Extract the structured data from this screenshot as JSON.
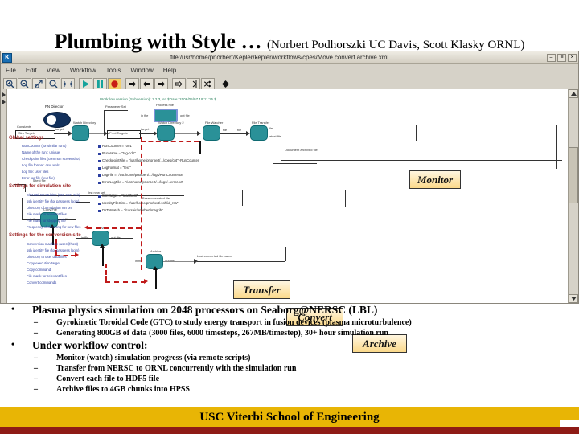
{
  "slide": {
    "title": "Plumbing with Style …",
    "subtitle": "(Norbert Podhorszki UC Davis, Scott Klasky ORNL)"
  },
  "window": {
    "app_icon": "K",
    "title": "file:/usr/home/pnorbert/Kepler/kepler/workflows/cpes/Move.convert.archive.xml",
    "buttons": {
      "minimize": "–",
      "maximize": "≡",
      "close": "×"
    },
    "menu": [
      "File",
      "Edit",
      "View",
      "Workflow",
      "Tools",
      "Window",
      "Help"
    ],
    "toolbar": [
      {
        "name": "zoom-in-icon",
        "glyph": "⊕"
      },
      {
        "name": "zoom-out-icon",
        "glyph": "⊖"
      },
      {
        "name": "zoom-reset-icon",
        "glyph": "⇲"
      },
      {
        "name": "zoom-fit-icon",
        "glyph": "⊝"
      },
      {
        "name": "fit-to-window-icon",
        "glyph": "⤢"
      },
      {
        "name": "run-icon",
        "glyph": "▶"
      },
      {
        "name": "pause-icon",
        "glyph": "❙❙"
      },
      {
        "name": "stop-icon",
        "glyph": "●"
      },
      {
        "name": "step-icon",
        "glyph": "➡"
      },
      {
        "name": "step-back-icon",
        "glyph": "⬅"
      },
      {
        "name": "step-forward-icon",
        "glyph": "➡"
      },
      {
        "name": "animate-icon",
        "glyph": "⇨"
      },
      {
        "name": "tag-icon",
        "glyph": "⤧"
      },
      {
        "name": "branch-icon",
        "glyph": "⇝"
      },
      {
        "name": "diamond-icon",
        "glyph": "◆"
      }
    ]
  },
  "canvas": {
    "version_note": "Workflow version (Subversion): 1.2.3, on $Date: 2006/05/07 19:11:15 $",
    "director_label": "PN Director",
    "parameter_set_label": "Parameter Set",
    "process_file_label": "Process File",
    "port_in_label": "in file",
    "port_out_label": "out file",
    "sections": [
      {
        "heading": "Global settings",
        "items": [
          "RunCounter (for similar runs)",
          "Name of the run : unique",
          "Checkpoint files (common screenshot)",
          "Log file format: csv, xmlc",
          "Log file: user files",
          "Error log file (text file)"
        ]
      },
      {
        "heading": "Settings for simulation site",
        "items": [
          "Simulation machine (use SSH ssh)",
          "ssh identity file (for passless login)",
          "Directory of simulation run on",
          "File mask for relevant files",
          "File mask for stopping file",
          "Frequency of checking for new files"
        ]
      },
      {
        "heading": "Settings for the conversion site",
        "items": [
          "Conversion machine (user@host)",
          "ssh identity file (for passless login)",
          "Directory to use, data files",
          "Copy execution target",
          "Copy command",
          "File mask for relevant files",
          "Convert commands"
        ]
      }
    ],
    "annotations": [
      "RunCounter = \"001\"",
      "RunName = \"tag-cdir\"",
      "CheckpointFile = \"/usr/home/pnorbert/.../cpes/cpt\"+RunCounter",
      "LogFormat = \"text\"",
      "LogFile = \"/usr/home/pnorbert/.../logs/RunCounter.txt\"",
      "ErrorLogFile = \"/usr/home/pnorbert/.../logs/...error.txt\"",
      "SimTarget = \"localhost\"",
      "IdentityFileSim = \"/usr/home/pnorbert/.ssh/id_rsa\"",
      "DirToWatch = \"/corsair/pnorbert/magrib\""
    ],
    "nodes": [
      {
        "label": "Process File",
        "name": "process-file-node"
      },
      {
        "label": "Watch Directory",
        "name": "watch-directory-node"
      },
      {
        "label": "Pred Targets",
        "name": "pred-targets-node"
      },
      {
        "label": "Watch Directory 2",
        "name": "watch-directory-2-node"
      },
      {
        "label": "File Watcher",
        "name": "file-watcher-node"
      },
      {
        "label": "File Transfer",
        "name": "file-transfer-node"
      },
      {
        "label": "Copy File",
        "name": "copy-file-node"
      },
      {
        "label": "Convert",
        "name": "convert-node"
      },
      {
        "label": "Archive",
        "name": "archive-node"
      }
    ],
    "edge_labels": [
      "Constants",
      "Sim Targets",
      "target",
      "target",
      "file",
      "file",
      "latest file",
      "first new set",
      "Document archived file",
      "Base converted file",
      "Last converted file name",
      "in file",
      "out file"
    ],
    "callouts": [
      {
        "label": "Monitor",
        "name": "callout-monitor"
      },
      {
        "label": "Transfer",
        "name": "callout-transfer"
      },
      {
        "label": "Convert",
        "name": "callout-convert"
      },
      {
        "label": "Archive",
        "name": "callout-archive"
      }
    ]
  },
  "bullets": [
    {
      "level": 1,
      "text": "Plasma physics simulation on 2048 processors on Seaborg@NERSC (LBL)"
    },
    {
      "level": 2,
      "text": "Gyrokinetic Toroidal Code (GTC) to study energy transport in fusion devices (plasma microturbulence)"
    },
    {
      "level": 2,
      "text": "Generating 800GB of data (3000 files, 6000 timesteps, 267MB/timestep), 30+ hour simulation run"
    },
    {
      "level": 1,
      "text": "Under workflow control:"
    },
    {
      "level": 2,
      "text": "Monitor (watch) simulation progress (via remote scripts)"
    },
    {
      "level": 2,
      "text": "Transfer from NERSC to ORNL concurrently with the simulation run"
    },
    {
      "level": 2,
      "text": "Convert each file to HDF5 file"
    },
    {
      "level": 2,
      "text": "Archive files to 4GB chunks into HPSS"
    }
  ],
  "footer": {
    "text": "USC Viterbi School of Engineering"
  },
  "colors": {
    "node_teal": "#2a9198",
    "callout_yellow": "#fbd98b",
    "dashed_red": "#c01a1a",
    "footer_gold": "#e8b505",
    "footer_red": "#8e1b16",
    "section_heading": "#9b2222",
    "param_blue": "#2b3ea0",
    "version_green": "#1f7a54"
  }
}
